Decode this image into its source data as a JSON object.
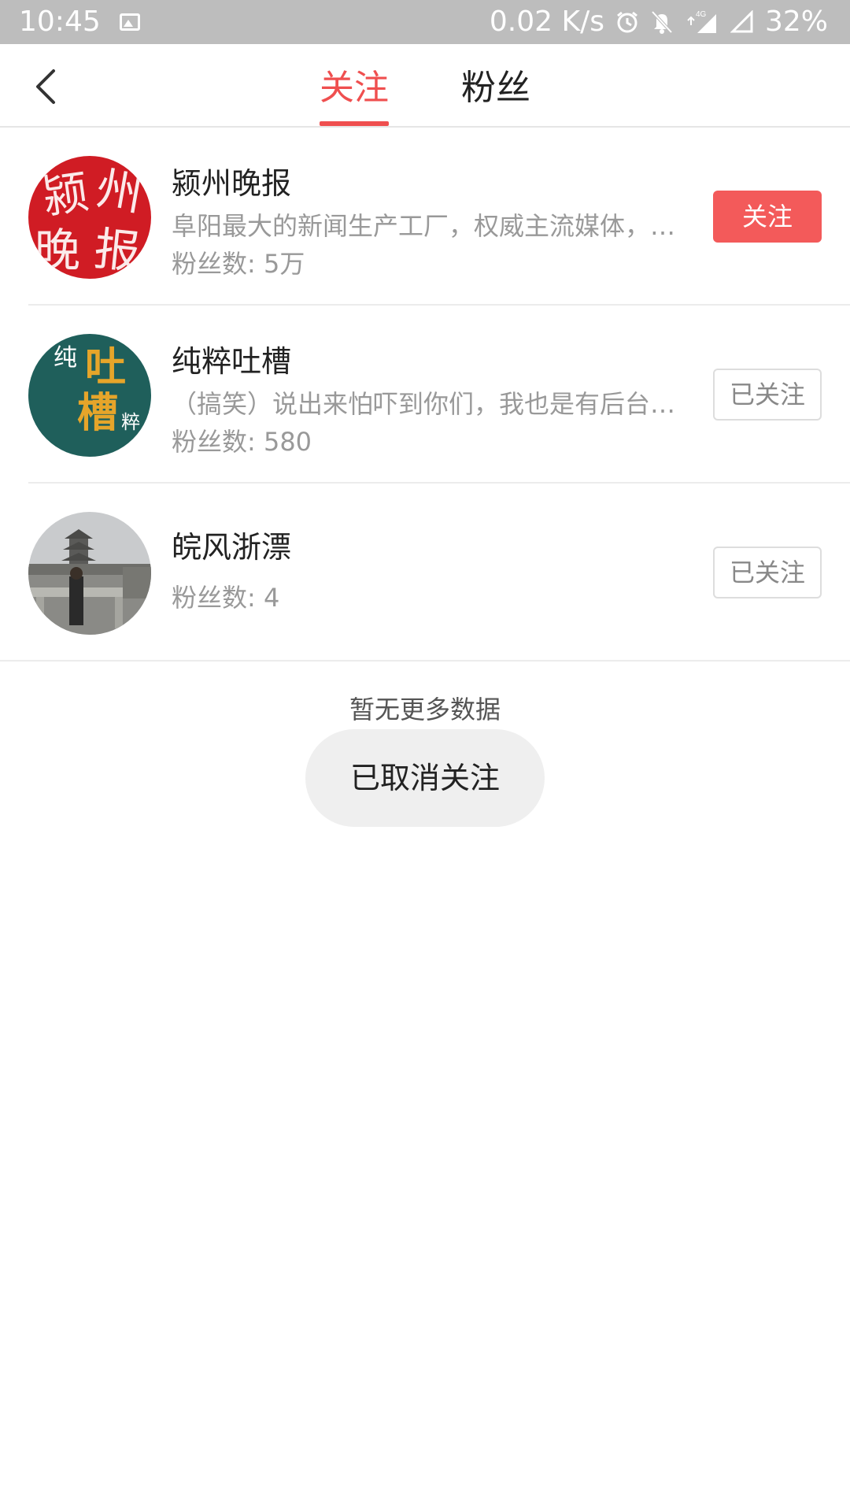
{
  "status_bar": {
    "time": "10:45",
    "speed": "0.02 K/s",
    "network": "4G",
    "battery": "32%"
  },
  "header": {
    "tabs": [
      {
        "label": "关注",
        "active": true
      },
      {
        "label": "粉丝",
        "active": false
      }
    ]
  },
  "colors": {
    "accent": "#ef4f4f",
    "follow_button": "#f35a5a"
  },
  "list": [
    {
      "name": "颍州晚报",
      "description": "阜阳最大的新闻生产工厂，权威主流媒体，…",
      "fans": "粉丝数: 5万",
      "button": "关注",
      "followed": false,
      "avatar_text": [
        "颍",
        "州",
        "晚",
        "报"
      ]
    },
    {
      "name": "纯粹吐槽",
      "description": "（搞笑）说出来怕吓到你们，我也是有后台…",
      "fans": "粉丝数: 580",
      "button": "已关注",
      "followed": true,
      "avatar_text": [
        "纯",
        "吐",
        "槽",
        "粹"
      ]
    },
    {
      "name": "皖风浙漂",
      "description": "",
      "fans": "粉丝数: 4",
      "button": "已关注",
      "followed": true
    }
  ],
  "footer": {
    "no_more": "暂无更多数据"
  },
  "toast": {
    "text": "已取消关注"
  }
}
